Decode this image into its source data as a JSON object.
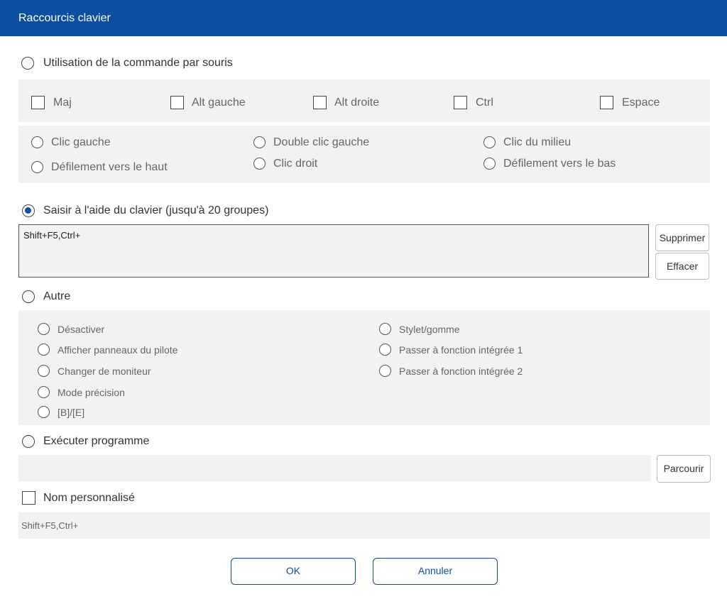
{
  "window": {
    "title": "Raccourcis clavier"
  },
  "mouse_command": {
    "label": "Utilisation de la commande par souris",
    "modifiers": [
      "Maj",
      "Alt gauche",
      "Alt droite",
      "Ctrl",
      "Espace"
    ],
    "actions": [
      "Clic gauche",
      "Défilement vers le haut",
      "Double clic gauche",
      "Clic droit",
      "Clic du milieu",
      "Défilement vers le bas"
    ]
  },
  "keyboard_input": {
    "label": "Saisir à l'aide du clavier (jusqu'à 20 groupes)",
    "value": "Shift+F5,Ctrl+",
    "delete_button": "Supprimer",
    "clear_button": "Effacer"
  },
  "other": {
    "label": "Autre",
    "options": [
      "Désactiver",
      "Afficher panneaux du pilote",
      "Changer de moniteur",
      "Mode précision",
      "[B]/[E]",
      "Stylet/gomme",
      "Passer à fonction intégrée 1",
      "Passer à fonction intégrée 2"
    ]
  },
  "run_program": {
    "label": "Exécuter programme",
    "browse_button": "Parcourir"
  },
  "custom_name": {
    "label": "Nom personnalisé",
    "value": "Shift+F5,Ctrl+"
  },
  "footer": {
    "ok_button": "OK",
    "cancel_button": "Annuler"
  },
  "colors": {
    "accent": "#0b4ea2",
    "panel": "#f2f2f2"
  }
}
